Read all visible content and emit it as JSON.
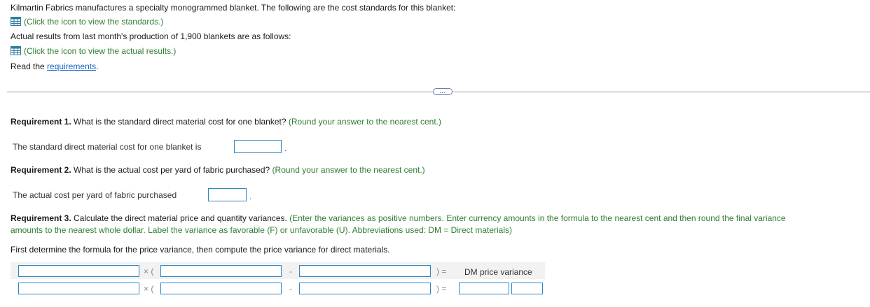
{
  "intro": {
    "line1": "Kilmartin Fabrics manufactures a specialty monogrammed blanket. The following are the cost standards for this blanket:",
    "standards_link": "(Click the icon to view the standards.)",
    "line2": "Actual results from last month's production of 1,900 blankets are as follows:",
    "actual_link": "(Click the icon to view the actual results.)",
    "read_prefix": "Read the ",
    "requirements_link": "requirements",
    "read_suffix": "."
  },
  "expander": {
    "label": "…"
  },
  "req1": {
    "title": "Requirement 1.",
    "question": "What is the standard direct material cost for one blanket?",
    "hint": "(Round your answer to the nearest cent.)",
    "answer_label": "The standard direct material cost for one blanket is",
    "answer_suffix": ".",
    "answer_value": ""
  },
  "req2": {
    "title": "Requirement 2.",
    "question": "What is the actual cost per yard of fabric purchased?",
    "hint": "(Round your answer to the nearest cent.)",
    "answer_label": "The actual cost per yard of fabric purchased",
    "answer_suffix": ".",
    "answer_value": ""
  },
  "req3": {
    "title": "Requirement 3.",
    "question": "Calculate the direct material price and quantity variances.",
    "hint_line1": "(Enter the variances as positive numbers. Enter currency amounts in the formula to the nearest cent and then round the final variance",
    "hint_line2": "amounts to the nearest whole dollar. Label the variance as favorable (F) or unfavorable (U). Abbreviations used: DM = Direct materials)",
    "instruction": "First determine the formula for the price variance, then compute the price variance for direct materials.",
    "formula": {
      "times_paren": "× (",
      "minus": "-",
      "close_eq": ")  =",
      "result_label": "DM price variance"
    }
  }
}
